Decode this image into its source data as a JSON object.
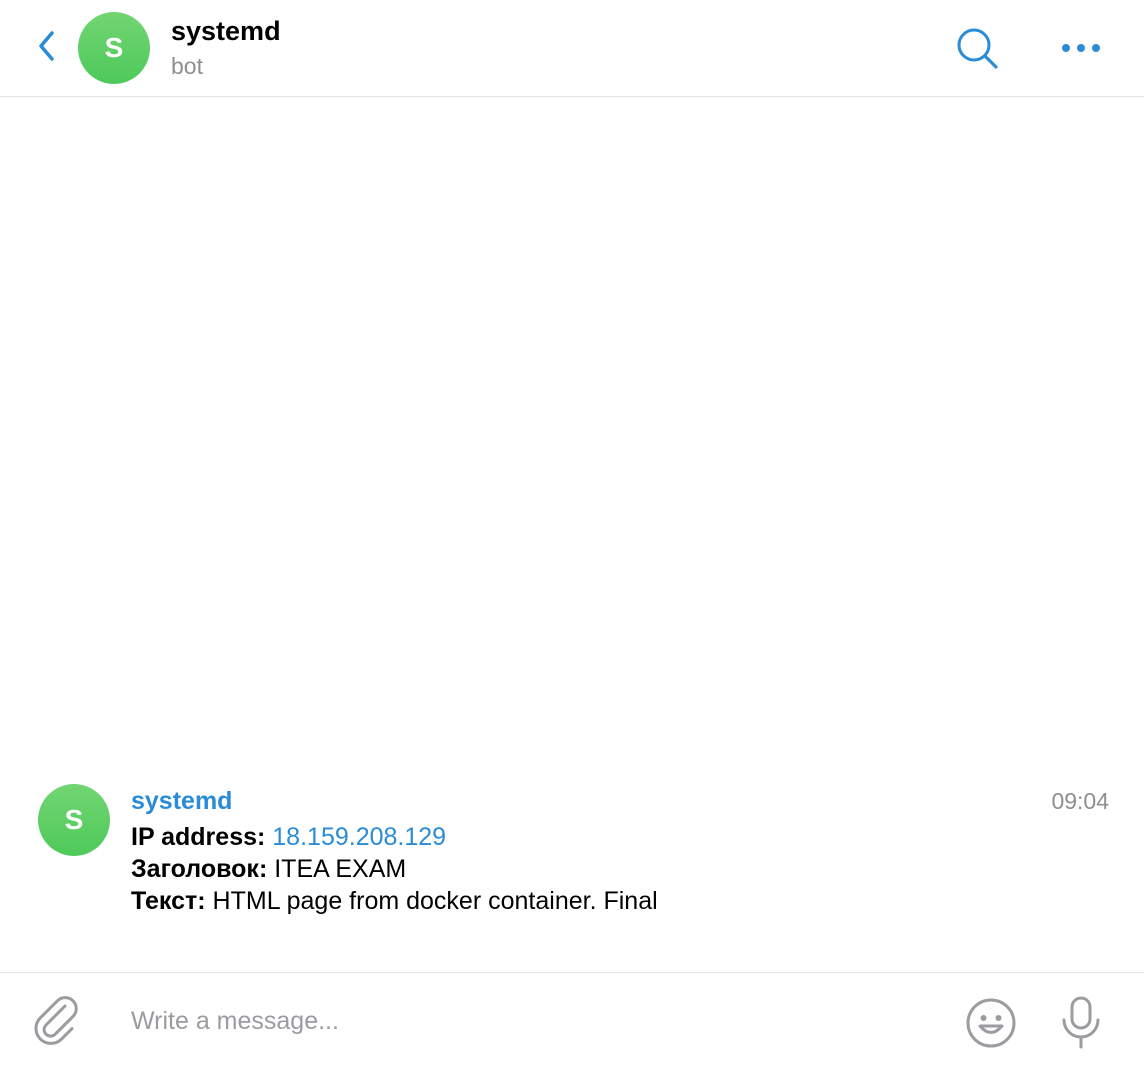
{
  "header": {
    "title": "systemd",
    "subtitle": "bot",
    "avatar_letter": "S",
    "icons": {
      "back": "chevron-left-icon",
      "search": "search-icon",
      "more": "more-horizontal-icon"
    }
  },
  "message": {
    "avatar_letter": "S",
    "sender": "systemd",
    "time": "09:04",
    "lines": [
      {
        "label": "IP address:",
        "value": "18.159.208.129"
      },
      {
        "label": "Заголовок:",
        "value": "ITEA EXAM"
      },
      {
        "label": "Текст:",
        "value": "HTML page from docker container. Final"
      }
    ]
  },
  "composer": {
    "placeholder": "Write a message...",
    "value": "",
    "icons": {
      "attach": "paperclip-icon",
      "emoji": "emoji-icon",
      "mic": "microphone-icon"
    }
  },
  "colors": {
    "accent": "#2a8bd6",
    "avatar": "#5ccc64",
    "muted": "#8e8e93",
    "divider": "#e4e4e4"
  }
}
